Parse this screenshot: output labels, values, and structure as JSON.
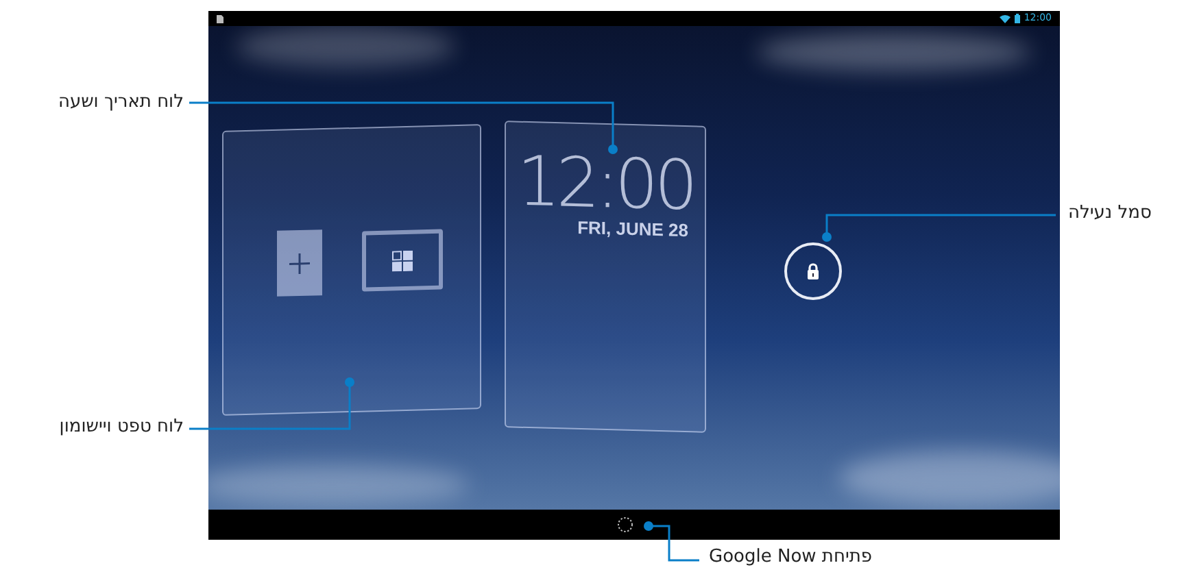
{
  "status_bar": {
    "time": "12:00"
  },
  "lock_screen": {
    "clock_panel": {
      "time": "12:00",
      "date": "FRI, JUNE 28"
    }
  },
  "callouts": {
    "clock_panel": "לוח תאריך ושעה",
    "widget_panel": "לוח טפט ויישומון",
    "lock_icon": "סמל נעילה",
    "google_now": "פתיחת Google Now"
  }
}
